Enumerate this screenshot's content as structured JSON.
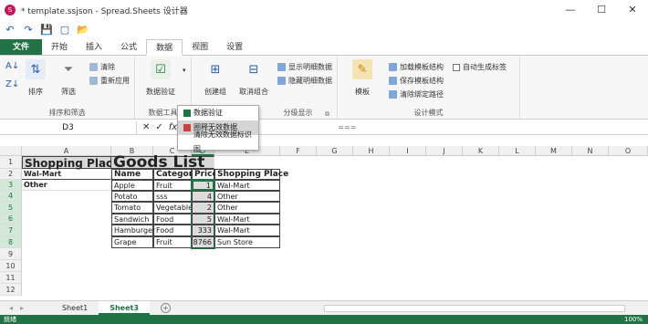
{
  "window": {
    "title": "* template.ssjson - Spread.Sheets 设计器",
    "min": "—",
    "max": "☐",
    "close": "✕"
  },
  "qat": {
    "undo": "↶",
    "redo": "↷",
    "save": "💾",
    "new": "▢",
    "open": "📂"
  },
  "tabs": [
    "文件",
    "开始",
    "插入",
    "公式",
    "数据",
    "视图",
    "设置"
  ],
  "active_tab": "数据",
  "ribbon": {
    "sort_filter": {
      "label": "排序和筛选",
      "sort": "排序",
      "filter": "筛选",
      "clear": "清除",
      "reapply": "重新应用"
    },
    "data_tools": {
      "label": "数据工具",
      "validation": "数据验证"
    },
    "outline": {
      "label": "分级显示",
      "group": "创建组",
      "ungroup": "取消组合",
      "show_detail": "显示明细数据",
      "hide_detail": "隐藏明细数据"
    },
    "design": {
      "label": "设计模式",
      "template": "模板",
      "load_schema": "加载模板结构",
      "save_schema": "保存模板结构",
      "clear_binding": "清除绑定路径",
      "auto_label": "自动生成标签"
    }
  },
  "dropdown": {
    "items": [
      "数据验证",
      "圈释无效数据",
      "清除无效数据标识图"
    ]
  },
  "formula_bar": {
    "name_box": "D3",
    "cancel": "✕",
    "confirm": "✓",
    "fx": "fx",
    "content": "==="
  },
  "columns": [
    "A",
    "B",
    "C",
    "D",
    "E",
    "F",
    "G",
    "H",
    "I",
    "J",
    "K",
    "L",
    "M",
    "N",
    "O"
  ],
  "rows": [
    "1",
    "2",
    "3",
    "4",
    "5",
    "6",
    "7",
    "8",
    "9",
    "10",
    "11",
    "12"
  ],
  "cells": {
    "a1": "Shopping Place",
    "b1": "Goods List",
    "a2": "Wal-Mart",
    "a3": "Other",
    "headers": [
      "Name",
      "Category",
      "Price",
      "Shopping Place"
    ],
    "table": [
      [
        "Apple",
        "Fruit",
        "1",
        "Wal-Mart"
      ],
      [
        "Potato",
        "sss",
        "4",
        "Other"
      ],
      [
        "Tomato",
        "Vegetable",
        "2",
        "Other"
      ],
      [
        "Sandwich",
        "Food",
        "5",
        "Wal-Mart"
      ],
      [
        "Hamburger",
        "Food",
        "333",
        "Wal-Mart"
      ],
      [
        "Grape",
        "Fruit",
        "8766",
        "Sun Store"
      ]
    ]
  },
  "sheets": [
    "Sheet1",
    "Sheet3"
  ],
  "active_sheet": "Sheet3",
  "status": {
    "left": "就绪",
    "zoom": "100%"
  }
}
